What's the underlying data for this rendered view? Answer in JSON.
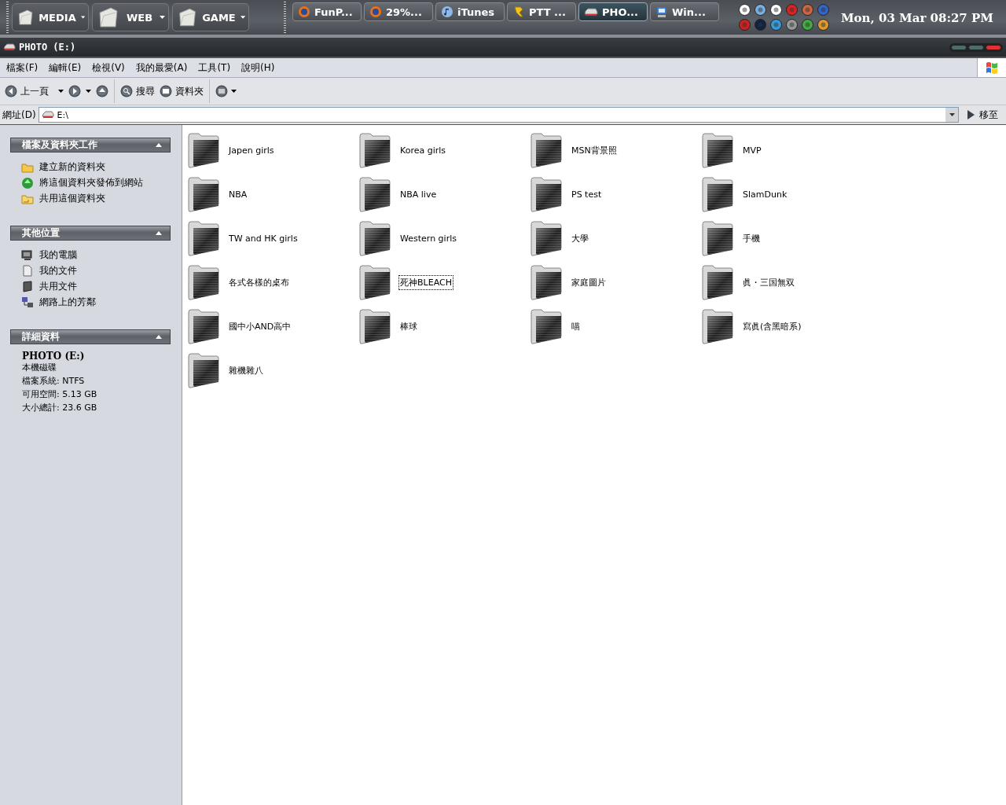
{
  "taskbar": {
    "quick_launch": [
      {
        "label": "MEDIA"
      },
      {
        "label": "WEB"
      },
      {
        "label": "GAME"
      }
    ],
    "tasks": [
      {
        "label": "FunP...",
        "selected": false
      },
      {
        "label": "29%...",
        "selected": false
      },
      {
        "label": "iTunes",
        "selected": false
      },
      {
        "label": "PTT ...",
        "selected": false
      },
      {
        "label": "PHO...",
        "selected": true
      },
      {
        "label": "Win...",
        "selected": false
      }
    ],
    "clock": "Mon, 03 Mar 08:27 PM"
  },
  "window": {
    "title": "PHOTO (E:)"
  },
  "menu": [
    "檔案(F)",
    "編輯(E)",
    "檢視(V)",
    "我的最愛(A)",
    "工具(T)",
    "說明(H)"
  ],
  "toolbar": {
    "back": "上一頁",
    "search": "搜尋",
    "folders": "資料夾"
  },
  "address": {
    "label": "網址(D)",
    "value": "E:\\",
    "go": "移至"
  },
  "sidebar": {
    "panels": [
      {
        "title": "檔案及資料夾工作",
        "expanded": true,
        "items": [
          "建立新的資料夾",
          "將這個資料夾發佈到網站",
          "共用這個資料夾"
        ]
      },
      {
        "title": "其他位置",
        "expanded": true,
        "items": [
          "我的電腦",
          "我的文件",
          "共用文件",
          "網路上的芳鄰"
        ]
      },
      {
        "title": "詳細資料",
        "expanded": true,
        "details": {
          "name": "PHOTO (E:)",
          "lines": [
            "本機磁碟",
            "檔案系統: NTFS",
            "可用空間: 5.13 GB",
            "大小總計: 23.6 GB"
          ]
        }
      }
    ]
  },
  "folders": [
    {
      "name": "Japen girls",
      "selected": false
    },
    {
      "name": "Korea girls",
      "selected": false
    },
    {
      "name": "MSN背景照",
      "selected": false
    },
    {
      "name": "MVP",
      "selected": false
    },
    {
      "name": "NBA",
      "selected": false
    },
    {
      "name": "NBA live",
      "selected": false
    },
    {
      "name": "PS test",
      "selected": false
    },
    {
      "name": "SlamDunk",
      "selected": false
    },
    {
      "name": "TW and HK girls",
      "selected": false
    },
    {
      "name": "Western girls",
      "selected": false
    },
    {
      "name": "大學",
      "selected": false
    },
    {
      "name": "手機",
      "selected": false
    },
    {
      "name": "各式各樣的桌布",
      "selected": false
    },
    {
      "name": "死神BLEACH",
      "selected": true
    },
    {
      "name": "家庭圖片",
      "selected": false
    },
    {
      "name": "眞・三国無双",
      "selected": false
    },
    {
      "name": "國中小AND高中",
      "selected": false
    },
    {
      "name": "棒球",
      "selected": false
    },
    {
      "name": "喵",
      "selected": false
    },
    {
      "name": "寫眞(含黑暗系)",
      "selected": false
    },
    {
      "name": "雜機雜八",
      "selected": false
    }
  ]
}
